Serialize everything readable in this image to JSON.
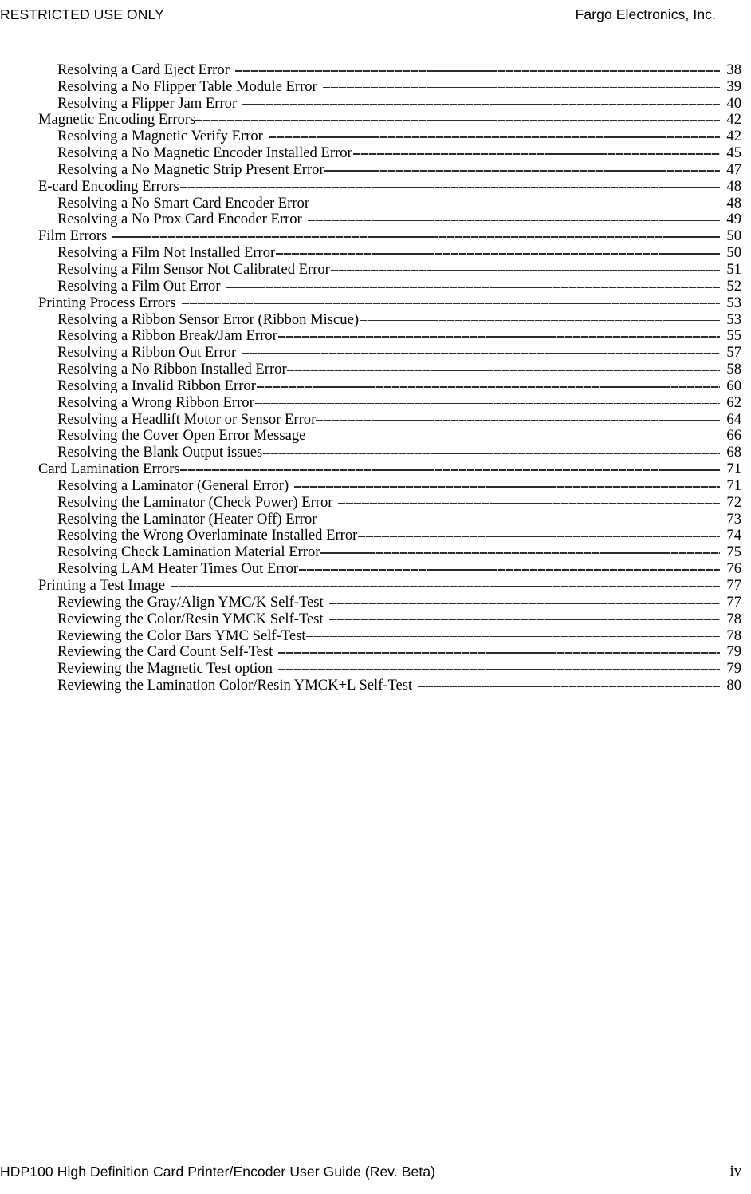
{
  "header": {
    "left": "RESTRICTED USE ONLY",
    "right": "Fargo Electronics, Inc."
  },
  "footer": {
    "left": "HDP100 High Definition Card Printer/Encoder User Guide (Rev. Beta)",
    "page_number": "iv"
  },
  "toc": {
    "entries": [
      {
        "level": 2,
        "title": "Resolving a Card Eject Error",
        "page": "38",
        "leader": "gap"
      },
      {
        "level": 2,
        "title": "Resolving a No Flipper Table Module Error",
        "page": "39",
        "leader": "gap"
      },
      {
        "level": 2,
        "title": "Resolving a Flipper Jam Error",
        "page": "40",
        "leader": "gap"
      },
      {
        "level": 1,
        "title": "Magnetic Encoding Errors",
        "page": "42",
        "leader": "tight"
      },
      {
        "level": 2,
        "title": "Resolving a Magnetic Verify Error",
        "page": "42",
        "leader": "gap"
      },
      {
        "level": 2,
        "title": "Resolving a No Magnetic Encoder Installed Error",
        "page": "45",
        "leader": "normal"
      },
      {
        "level": 2,
        "title": "Resolving a No Magnetic Strip Present Error",
        "page": "47",
        "leader": "tight"
      },
      {
        "level": 1,
        "title": "E-card Encoding Errors",
        "page": "48",
        "leader": "normal"
      },
      {
        "level": 2,
        "title": "Resolving a No Smart Card Encoder Error",
        "page": "48",
        "leader": "tight"
      },
      {
        "level": 2,
        "title": "Resolving a No Prox Card Encoder Error",
        "page": "49",
        "leader": "gap"
      },
      {
        "level": 1,
        "title": "Film Errors",
        "page": "50",
        "leader": "gap"
      },
      {
        "level": 2,
        "title": "Resolving a Film Not Installed Error",
        "page": "50",
        "leader": "normal"
      },
      {
        "level": 2,
        "title": "Resolving a Film Sensor Not Calibrated Error",
        "page": "51",
        "leader": "normal"
      },
      {
        "level": 2,
        "title": "Resolving a Film Out Error",
        "page": "52",
        "leader": "gap"
      },
      {
        "level": 1,
        "title": "Printing Process Errors",
        "page": "53",
        "leader": "gap"
      },
      {
        "level": 2,
        "title": "Resolving a Ribbon Sensor Error (Ribbon Miscue)",
        "page": "53",
        "leader": "normal"
      },
      {
        "level": 2,
        "title": "Resolving a Ribbon Break/Jam Error",
        "page": "55",
        "leader": "normal"
      },
      {
        "level": 2,
        "title": "Resolving a Ribbon Out Error",
        "page": "57",
        "leader": "gap"
      },
      {
        "level": 2,
        "title": "Resolving a No Ribbon Installed Error",
        "page": "58",
        "leader": "tight"
      },
      {
        "level": 2,
        "title": "Resolving a Invalid Ribbon Error",
        "page": "60",
        "leader": "normal"
      },
      {
        "level": 2,
        "title": "Resolving a Wrong Ribbon Error",
        "page": "62",
        "leader": "normal"
      },
      {
        "level": 2,
        "title": "Resolving a Headlift Motor or Sensor Error",
        "page": "64",
        "leader": "tight"
      },
      {
        "level": 2,
        "title": "Resolving the Cover Open Error Message",
        "page": "66",
        "leader": "normal"
      },
      {
        "level": 2,
        "title": "Resolving the Blank Output issues",
        "page": "68",
        "leader": "normal"
      },
      {
        "level": 1,
        "title": "Card Lamination Errors",
        "page": "71",
        "leader": "tight"
      },
      {
        "level": 2,
        "title": "Resolving a Laminator (General Error)",
        "page": "71",
        "leader": "gap"
      },
      {
        "level": 2,
        "title": "Resolving the Laminator (Check Power) Error",
        "page": "72",
        "leader": "gap"
      },
      {
        "level": 2,
        "title": "Resolving the Laminator (Heater Off) Error",
        "page": "73",
        "leader": "gap"
      },
      {
        "level": 2,
        "title": "Resolving the Wrong Overlaminate Installed Error",
        "page": "74",
        "leader": "normal"
      },
      {
        "level": 2,
        "title": "Resolving Check Lamination Material Error",
        "page": "75",
        "leader": "normal"
      },
      {
        "level": 2,
        "title": "Resolving LAM Heater Times Out Error",
        "page": "76",
        "leader": "normal"
      },
      {
        "level": 1,
        "title": "Printing a Test Image",
        "page": "77",
        "leader": "gap"
      },
      {
        "level": 2,
        "title": "Reviewing the Gray/Align YMC/K Self-Test",
        "page": "77",
        "leader": "gap"
      },
      {
        "level": 2,
        "title": "Reviewing the Color/Resin YMCK Self-Test",
        "page": "78",
        "leader": "gap"
      },
      {
        "level": 2,
        "title": "Reviewing the Color Bars YMC Self-Test",
        "page": "78",
        "leader": "normal"
      },
      {
        "level": 2,
        "title": "Reviewing the Card Count Self-Test",
        "page": "79",
        "leader": "gap"
      },
      {
        "level": 2,
        "title": "Reviewing the Magnetic Test option",
        "page": "79",
        "leader": "gap"
      },
      {
        "level": 2,
        "title": "Reviewing the Lamination Color/Resin YMCK+L Self-Test",
        "page": "80",
        "leader": "gap"
      }
    ]
  }
}
